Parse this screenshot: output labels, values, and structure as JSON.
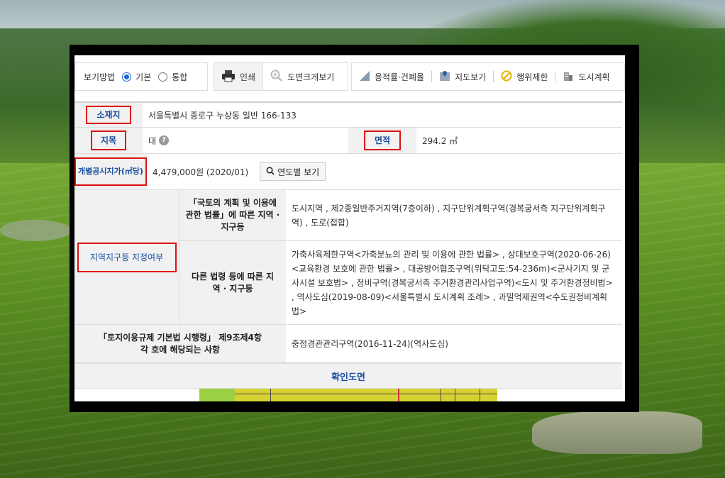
{
  "toolbar": {
    "view_label": "보기방법",
    "view_options": [
      {
        "label": "기본",
        "selected": true
      },
      {
        "label": "통합",
        "selected": false
      }
    ],
    "print_label": "인쇄",
    "zoom_map_label": "도면크게보기",
    "tools": [
      {
        "label": "용적률·건폐율",
        "icon": "ruler-triangle-icon"
      },
      {
        "label": "지도보기",
        "icon": "map-pin-icon"
      },
      {
        "label": "행위제한",
        "icon": "prohibited-icon"
      },
      {
        "label": "도시계획",
        "icon": "building-icon"
      }
    ]
  },
  "info": {
    "location_label": "소재지",
    "location_value": "서울특별시 종로구 누상동 일반 166-133",
    "land_category_label": "지목",
    "land_category_value": "대",
    "help_mark": "?",
    "area_label": "면적",
    "area_value": "294.2 ㎡",
    "price_label": "개별공시지가(㎡당)",
    "price_value": "4,479,000원 (2020/01)",
    "year_button": "연도별 보기",
    "zoning_label": "지역지구등 지정여부",
    "zoning_national_label": "「국토의 계획 및 이용에 관한 법률」에 따른 지역 · 지구등",
    "zoning_national_value": "도시지역 , 제2종일반주거지역(7층이하) , 지구단위계획구역(경복궁서측 지구단위계획구역) , 도로(접합)",
    "zoning_other_label": "다른 법령 등에 따른 지역 · 지구등",
    "zoning_other_value": "가축사육제한구역<가축분뇨의 관리 및 이용에 관한 법률> , 상대보호구역(2020-06-26)<교육환경 보호에 관한 법률> , 대공방어협조구역(위탁고도:54-236m)<군사기지 및 군사시설 보호법> , 정비구역(경복궁서측 주거환경관리사업구역)<도시 및 주거환경정비법> , 역사도심(2019-08-09)<서울특별시 도시계획 조례> , 과밀억제권역<수도권정비계획법>",
    "enforcement_label": "「토지이용규제 기본법 시행령」 제9조제4항 각 호에 해당되는 사항",
    "enforcement_value": "중점경관관리구역(2016-11-24)(역사도심)",
    "confirm_map_label": "확인도면"
  },
  "colors": {
    "highlight_border": "#dd1111",
    "label_blue": "#1a4fa0",
    "radio_blue": "#1a66d2"
  }
}
